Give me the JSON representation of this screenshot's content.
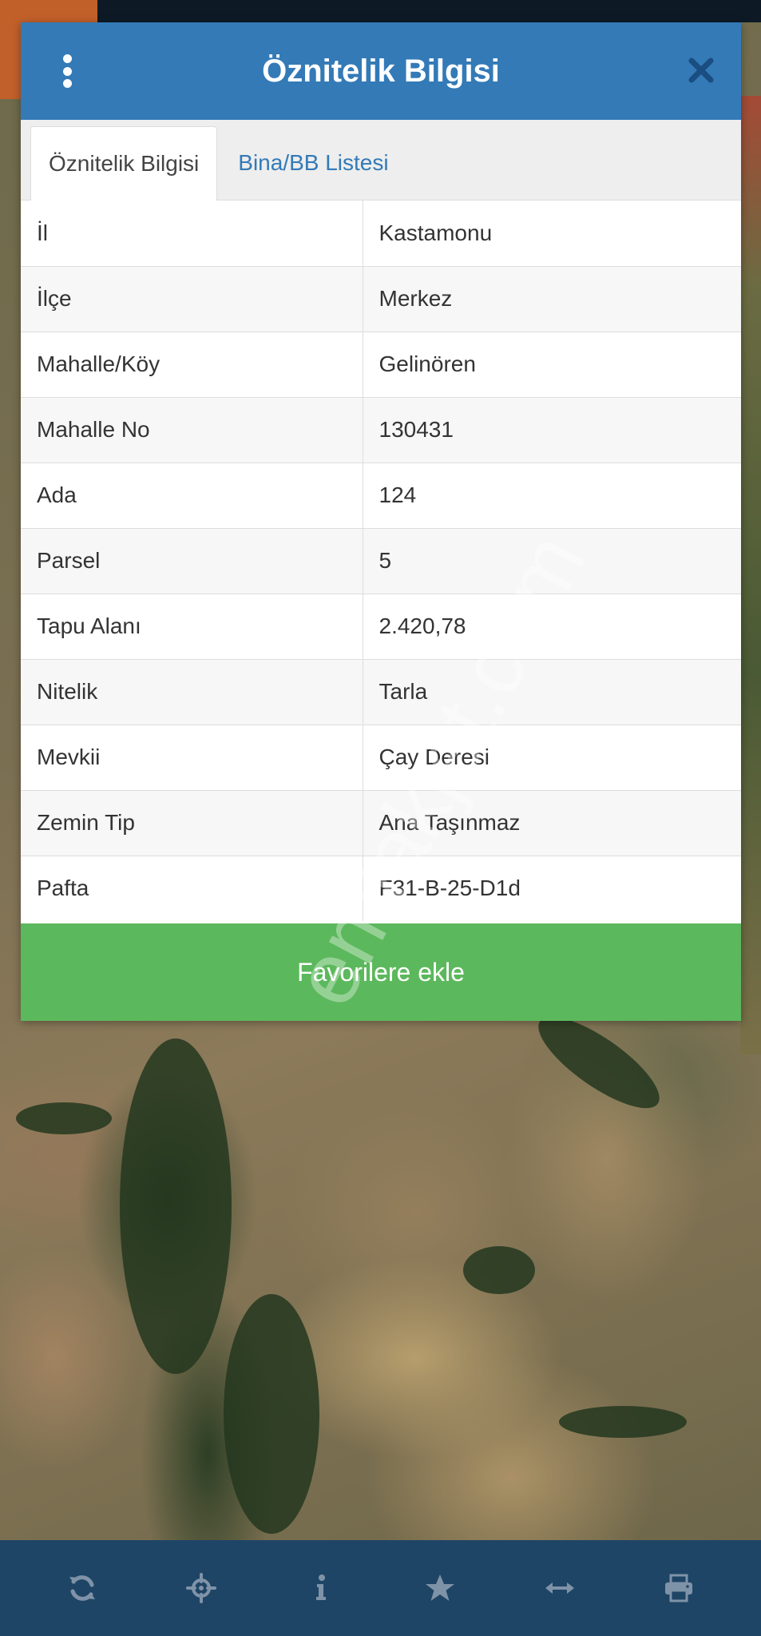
{
  "dialog": {
    "title": "Öznitelik Bilgisi"
  },
  "tabs": [
    {
      "label": "Öznitelik Bilgisi",
      "active": true
    },
    {
      "label": "Bina/BB Listesi",
      "active": false
    }
  ],
  "attributes": [
    {
      "key": "İl",
      "value": "Kastamonu"
    },
    {
      "key": "İlçe",
      "value": "Merkez"
    },
    {
      "key": "Mahalle/Köy",
      "value": "Gelinören"
    },
    {
      "key": "Mahalle No",
      "value": "130431"
    },
    {
      "key": "Ada",
      "value": "124"
    },
    {
      "key": "Parsel",
      "value": "5"
    },
    {
      "key": "Tapu Alanı",
      "value": "2.420,78"
    },
    {
      "key": "Nitelik",
      "value": "Tarla"
    },
    {
      "key": "Mevkii",
      "value": "Çay Deresi"
    },
    {
      "key": "Zemin Tip",
      "value": "Ana Taşınmaz"
    },
    {
      "key": "Pafta",
      "value": "F31-B-25-D1d"
    }
  ],
  "favorite_button": {
    "label": "Favorilere ekle"
  },
  "watermark": "emlakjet.com",
  "toolbar": {
    "icons": [
      "refresh-icon",
      "crosshair-icon",
      "info-icon",
      "star-icon",
      "measure-icon",
      "print-icon"
    ]
  },
  "colors": {
    "header": "#337ab7",
    "favorite_button": "#5cb85c",
    "toolbar": "#1f4566"
  }
}
